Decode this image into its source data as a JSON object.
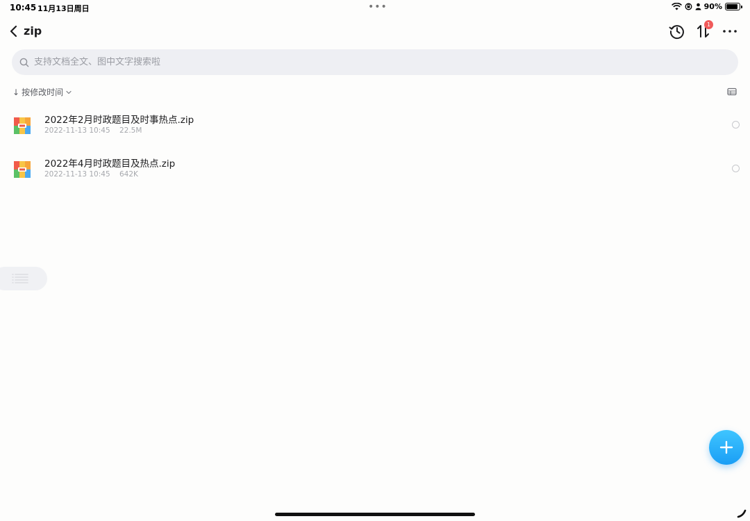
{
  "status_bar": {
    "time": "10:45",
    "date": "11月13日周日",
    "multitask_dots": "•••",
    "battery_percent": "90%",
    "battery_level": 0.9
  },
  "nav": {
    "title": "zip",
    "transfer_badge": "1"
  },
  "search": {
    "placeholder": "支持文档全文、图中文字搜索啦"
  },
  "sort": {
    "arrow": "↓",
    "label": "按修改时间"
  },
  "files": [
    {
      "name": "2022年2月时政题目及时事热点.zip",
      "date": "2022-11-13 10:45",
      "size": "22.5M"
    },
    {
      "name": "2022年4月时政题目及热点.zip",
      "date": "2022-11-13 10:45",
      "size": "642K"
    }
  ],
  "colors": {
    "accent": "#1a9ef5",
    "badge": "#f05a5a",
    "search_bg": "#eeeff3"
  }
}
